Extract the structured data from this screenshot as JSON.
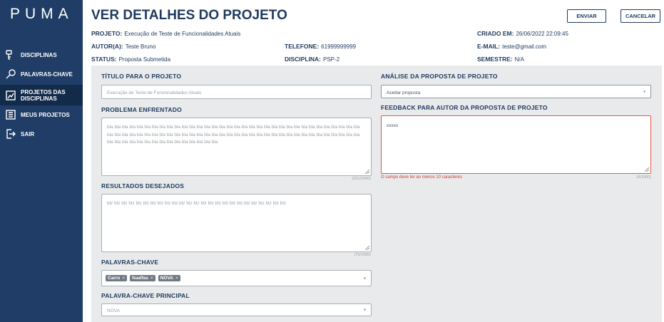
{
  "app": {
    "logo": "PUMA"
  },
  "sidebar": {
    "items": [
      {
        "label": "DISCIPLINAS",
        "icon": "key-icon"
      },
      {
        "label": "PALAVRAS-CHAVE",
        "icon": "search-icon"
      },
      {
        "label": "PROJETOS DAS DISCIPLINAS",
        "icon": "projects-icon",
        "active": true
      },
      {
        "label": "MEUS PROJETOS",
        "icon": "list-icon"
      },
      {
        "label": "SAIR",
        "icon": "logout-icon"
      }
    ]
  },
  "header": {
    "title": "VER DETALHES DO PROJETO",
    "send_label": "ENVIAR",
    "cancel_label": "CANCELAR",
    "projeto_label": "PROJETO:",
    "projeto_value": "Execução de Teste de Funcionalidades Atuais",
    "criado_label": "CRIADO EM:",
    "criado_value": "26/06/2022 22:09:45",
    "autor_label": "AUTOR(A):",
    "autor_value": "Teste Bruno",
    "telefone_label": "TELEFONE:",
    "telefone_value": "61999999999",
    "email_label": "E-MAIL:",
    "email_value": "teste@gmail.com",
    "status_label": "STATUS:",
    "status_value": "Proposta Submetida",
    "disciplina_label": "DISCIPLINA:",
    "disciplina_value": "PSP-2",
    "semestre_label": "SEMESTRE:",
    "semestre_value": "N/A"
  },
  "form": {
    "titulo_label": "TÍTULO PARA O PROJETO",
    "titulo_value": "Execução de Teste de Funcionalidades Atuais",
    "problema_label": "PROBLEMA ENFRENTADO",
    "problema_value": "bla bla bla bla bla bla bla bla bla bla bla bla bla bla bla bla bla bla bla bla bla bla bla bla bla bla bla bla bla bla bla bla bla bla bla bla bla bla bla bla bla bla bla bla bla bla bla bla bla bla bla bla bla bla bla bla bla bla bla bla bla bla bla bla bla bla bla bla bla bla bla bla bla bla bla bla bla bla bla bla bla bla bla",
    "problema_counter": "(251/1000)",
    "resultados_label": "RESULTADOS DESEJADOS",
    "resultados_value": "blz blz blz blz blz blz blz blz blz blz blz blz blz blz blz blz blz blz blz blz blz blz blz blz blz",
    "resultados_counter": "(75/1000)",
    "palavras_label": "PALAVRAS-CHAVE",
    "chips": [
      "Carro",
      "fsadfas",
      "NOVA"
    ],
    "principal_label": "PALAVRA-CHAVE PRINCIPAL",
    "principal_value": "NOVA",
    "analise_label": "ANÁLISE DA PROPOSTA DE PROJETO",
    "analise_value": "Aceitar proposta",
    "feedback_label": "FEEDBACK PARA AUTOR DA PROPOSTA DE PROJETO",
    "feedback_value": "xxxxx",
    "feedback_error": "O campo deve ter ao menos 10 caracteres",
    "feedback_counter": "(5/1000)"
  },
  "colors": {
    "sidebar": "#1f3d66",
    "sidebar_active": "#122b4b",
    "text": "#1f3a5f",
    "error": "#d33a2c",
    "form_bg": "#e9eaeb"
  }
}
